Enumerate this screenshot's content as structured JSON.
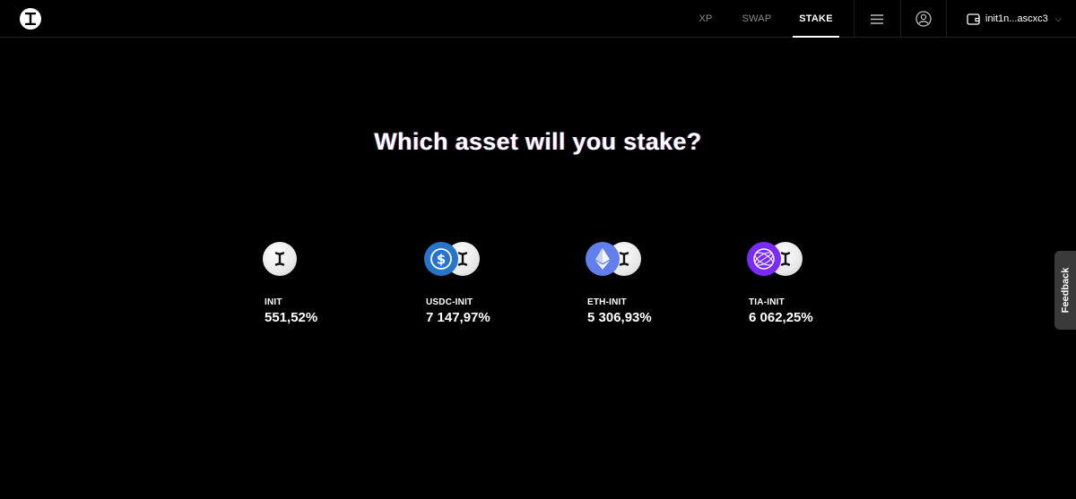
{
  "header": {
    "logo_icon": "initia-logo-icon",
    "tabs": [
      {
        "label": "XP"
      },
      {
        "label": "SWAP"
      },
      {
        "label": "STAKE"
      }
    ],
    "active_tab": "STAKE",
    "menu_icon": "hamburger-icon",
    "account_icon": "user-circle-icon",
    "wallet": {
      "icon": "wallet-icon",
      "address": "init1n...ascxc3",
      "chevron_icon": "chevron-down-icon"
    }
  },
  "main": {
    "title": "Which asset will you stake?",
    "assets": [
      {
        "name": "INIT",
        "apr": "551,52%",
        "icons": [
          "init-token-icon"
        ]
      },
      {
        "name": "USDC-INIT",
        "apr": "7 147,97%",
        "icons": [
          "usdc-token-icon",
          "init-token-icon"
        ]
      },
      {
        "name": "ETH-INIT",
        "apr": "5 306,93%",
        "icons": [
          "eth-token-icon",
          "init-token-icon"
        ]
      },
      {
        "name": "TIA-INIT",
        "apr": "6 062,25%",
        "icons": [
          "tia-token-icon",
          "init-token-icon"
        ]
      }
    ]
  },
  "feedback": {
    "label": "Feedback"
  },
  "colors": {
    "background": "#000000",
    "text": "#ffffff",
    "muted_text": "#8a8a8a",
    "usdc": "#2775ca",
    "eth": "#627eea",
    "tia": "#7b2bf9",
    "feedback_tab": "#3a3a3a"
  }
}
